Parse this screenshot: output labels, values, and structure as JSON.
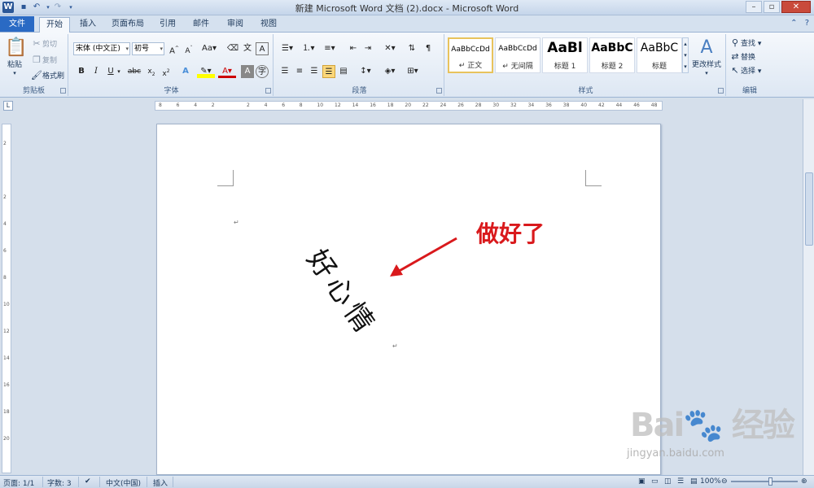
{
  "window": {
    "title": "新建 Microsoft Word 文档 (2).docx - Microsoft Word",
    "app_icon": "W"
  },
  "tabs": {
    "file": "文件",
    "items": [
      "开始",
      "插入",
      "页面布局",
      "引用",
      "邮件",
      "审阅",
      "视图"
    ]
  },
  "ribbon": {
    "clipboard": {
      "label": "剪贴板",
      "paste": "粘贴",
      "cut": "剪切",
      "copy": "复制",
      "format_painter": "格式刷"
    },
    "font": {
      "label": "字体",
      "font_name": "宋体 (中文正)",
      "font_size": "初号"
    },
    "paragraph": {
      "label": "段落"
    },
    "styles": {
      "label": "样式",
      "items": [
        {
          "sample": "AaBbCcDd",
          "name": "↵ 正文"
        },
        {
          "sample": "AaBbCcDd",
          "name": "↵ 无间隔"
        },
        {
          "sample": "AaBl",
          "name": "标题 1"
        },
        {
          "sample": "AaBbC",
          "name": "标题 2"
        },
        {
          "sample": "AaBbC",
          "name": "标题"
        }
      ],
      "change_styles": "更改样式"
    },
    "editing": {
      "label": "编辑",
      "find": "查找",
      "replace": "替换",
      "select": "选择"
    }
  },
  "ruler_ticks": [
    "8",
    "6",
    "4",
    "2",
    "",
    "2",
    "4",
    "6",
    "8",
    "10",
    "12",
    "14",
    "16",
    "18",
    "20",
    "22",
    "24",
    "26",
    "28",
    "30",
    "32",
    "34",
    "36",
    "38",
    "40",
    "42",
    "44",
    "46",
    "48"
  ],
  "vruler_ticks": [
    "2",
    "",
    "2",
    "4",
    "6",
    "8",
    "10",
    "12",
    "14",
    "16",
    "18",
    "20"
  ],
  "document": {
    "vertical_text": "好心情",
    "paragraph_mark": "↵",
    "annotation": "做好了"
  },
  "statusbar": {
    "page": "页面: 1/1",
    "words": "字数: 3",
    "language": "中文(中国)",
    "mode": "插入",
    "zoom": "100%"
  },
  "watermark": {
    "brand": "Bai du 经验",
    "url": "jingyan.baidu.com"
  },
  "colors": {
    "annotation": "#d9191c",
    "file_tab": "#2a6ac4"
  }
}
